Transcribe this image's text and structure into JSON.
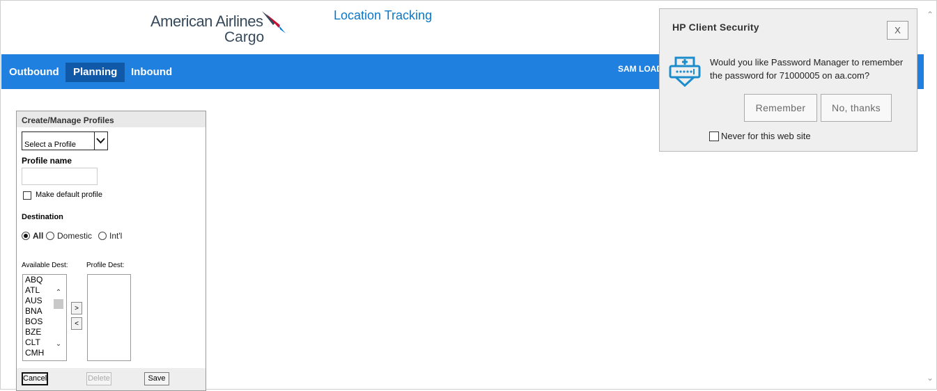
{
  "header": {
    "logo_line1": "American Airlines",
    "logo_line2": "Cargo",
    "app_title": "Location Tracking"
  },
  "nav": {
    "tabs": [
      {
        "label": "Outbound",
        "active": false
      },
      {
        "label": "Planning",
        "active": true
      },
      {
        "label": "Inbound",
        "active": false
      }
    ],
    "user": "SAM LOAD"
  },
  "profiles_panel": {
    "title": "Create/Manage Profiles",
    "select_value": "Select a Profile",
    "profile_name_label": "Profile name",
    "profile_name_value": "",
    "default_checkbox_label": "Make default profile",
    "destination_label": "Destination",
    "destination_options": [
      {
        "label": "All",
        "selected": true
      },
      {
        "label": "Domestic",
        "selected": false
      },
      {
        "label": "Int'l",
        "selected": false
      }
    ],
    "available_label": "Available Dest:",
    "profile_dest_label": "Profile Dest:",
    "available_dest": [
      "ABQ",
      "ATL",
      "AUS",
      "BNA",
      "BOS",
      "BZE",
      "CLT",
      "CMH"
    ],
    "add_label": ">",
    "remove_label": "<",
    "buttons": {
      "cancel": "Cancel",
      "delete": "Delete",
      "save": "Save"
    }
  },
  "popup": {
    "title": "HP Client Security",
    "close_label": "X",
    "message": "Would you like Password Manager to remember the password for 71000005 on aa.com?",
    "remember_label": "Remember",
    "no_thanks_label": "No, thanks",
    "never_label": "Never for this web site"
  },
  "colors": {
    "nav_bg": "#2080e0",
    "nav_active": "#1058a8",
    "title_blue": "#0a78c8",
    "logo_red": "#c8102e",
    "logo_blue": "#36495a",
    "popup_icon": "#1c8ccd"
  }
}
